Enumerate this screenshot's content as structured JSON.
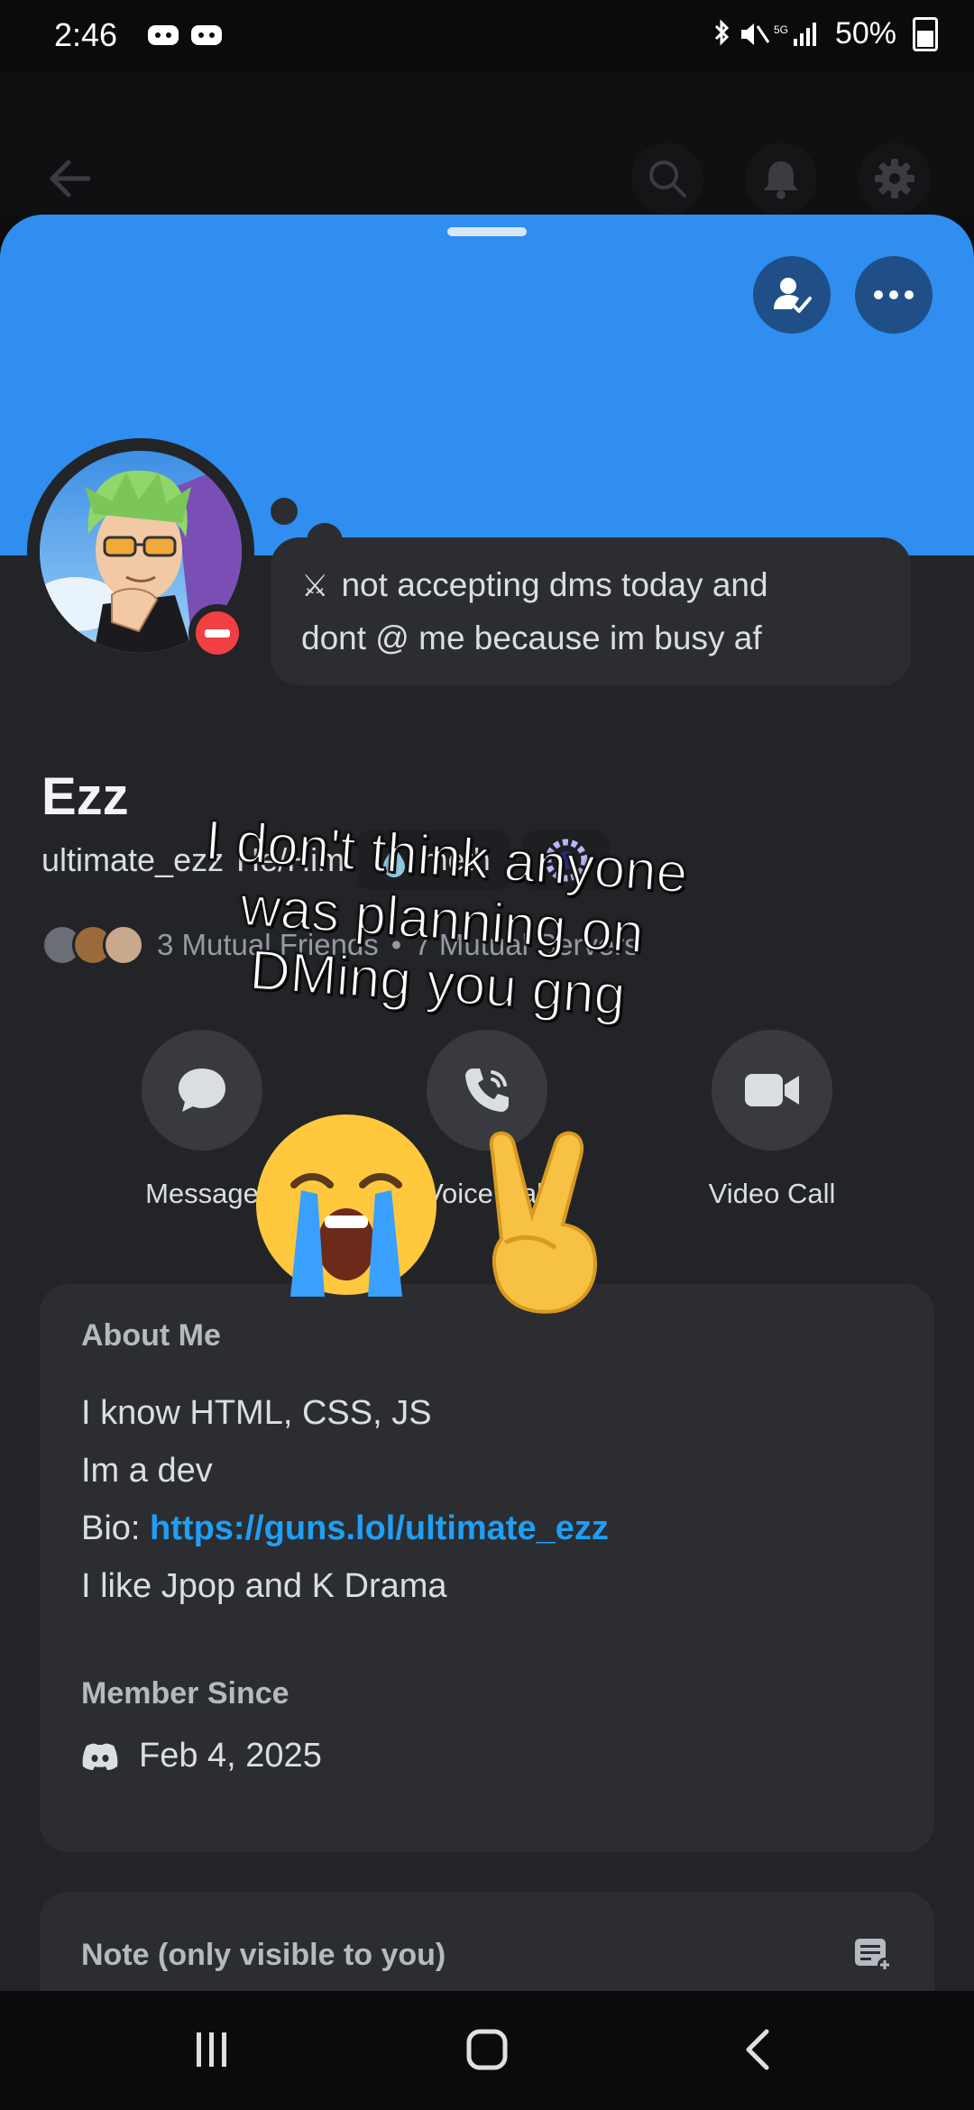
{
  "status_bar": {
    "time": "2:46",
    "battery": "50%",
    "network": "5G"
  },
  "nav": {
    "back_icon": "arrow-left-icon",
    "search_icon": "search-icon",
    "bell_icon": "bell-icon",
    "gear_icon": "gear-icon"
  },
  "profile": {
    "banner_color": "#2f8ef0",
    "display_name": "Ezz",
    "username": "ultimate_ezz",
    "pronouns": "He/Him",
    "tag": "meth",
    "custom_status": {
      "text_line1": "not accepting dms today and",
      "text_line2": "dont @ me because im busy af"
    },
    "mutuals": {
      "friends": "3 Mutual Friends",
      "separator": "•",
      "servers": "7 Mutual Servers"
    }
  },
  "actions": {
    "message": "Message",
    "voice_call": "Voice Call",
    "video_call": "Video Call"
  },
  "about": {
    "heading": "About Me",
    "line1": "I know HTML, CSS, JS",
    "line2": "Im a dev",
    "bio_prefix": "Bio: ",
    "bio_link": "https://guns.lol/ultimate_ezz",
    "line4": "I like Jpop and K Drama",
    "member_since_heading": "Member Since",
    "member_since_date": "Feb 4, 2025"
  },
  "note": {
    "label": "Note (only visible to you)"
  },
  "overlay": {
    "line1": "I don't think anyone",
    "line2": "was planning on",
    "line3": "DMing you gng",
    "emoji1": "😭",
    "emoji2": "✌️"
  },
  "colors": {
    "accent": "#2f8ef0",
    "dnd": "#f23f43",
    "link": "#1f9ff5"
  }
}
